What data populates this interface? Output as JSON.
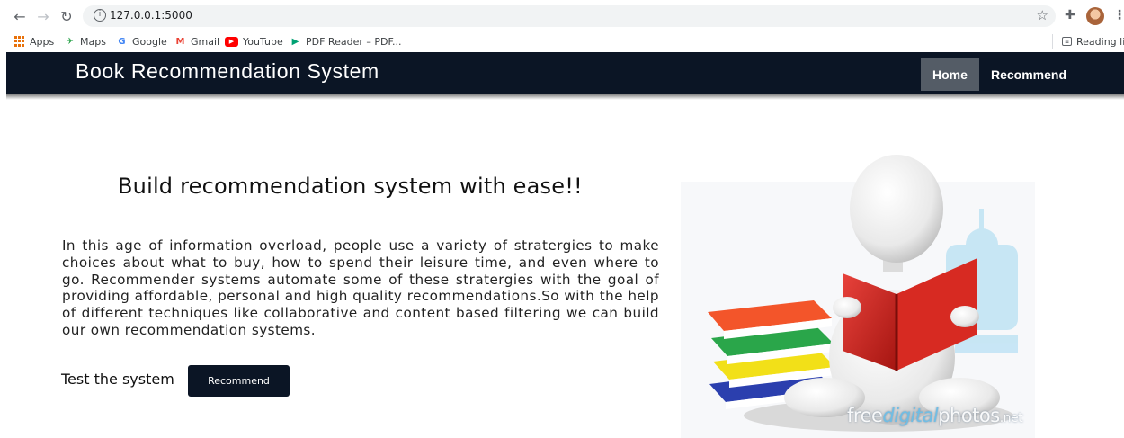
{
  "browser": {
    "url": "127.0.0.1:5000",
    "bookmarks": [
      {
        "label": "Apps"
      },
      {
        "label": "Maps"
      },
      {
        "label": "Google"
      },
      {
        "label": "Gmail"
      },
      {
        "label": "YouTube"
      },
      {
        "label": "PDF Reader – PDF..."
      }
    ],
    "reading_list": "Reading list"
  },
  "navbar": {
    "brand": "Book Recommendation System",
    "links": [
      {
        "label": "Home",
        "active": true
      },
      {
        "label": "Recommend",
        "active": false
      }
    ],
    "background": "#0b1525",
    "active_background": "#545c66"
  },
  "main": {
    "headline": "Build recommendation system with ease!!",
    "description": "In this age of information overload, people use a variety of stratergies to make choices about what to buy, how to spend their leisure time, and even where to go. Recommender systems automate some of these stratergies with the goal of providing affordable, personal and high quality recommendations.So with the help of different techniques like collaborative and content based filtering we can build our own recommendation systems.",
    "test_label": "Test the system",
    "button_label": "Recommend"
  },
  "illustration": {
    "watermark": {
      "part1": "free",
      "part2": "digital",
      "part3": "photos",
      "part4": ".net"
    }
  }
}
